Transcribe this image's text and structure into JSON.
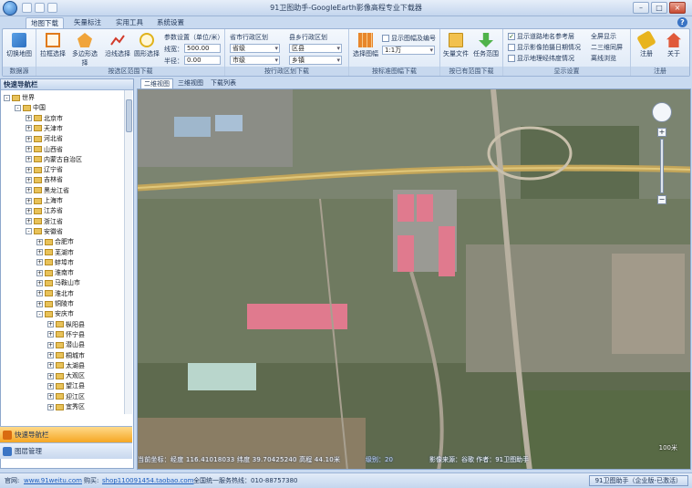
{
  "window": {
    "title": "91卫图助手-GoogleEarth影像高程专业下载器"
  },
  "ribbon_tabs": [
    "地图下载",
    "矢量标注",
    "实用工具",
    "系统设置"
  ],
  "groups": {
    "data_source": {
      "label": "数据源",
      "switch_map": "切换地图"
    },
    "range": {
      "label": "按选区范围下载",
      "rect_select": "拉框选择",
      "polygon_select": "多边形选择",
      "polyline_select": "沿线选择",
      "circle_select": "圆形选择",
      "params_title": "参数设置（单位/米）",
      "width_label": "线宽：",
      "width_value": "500.00",
      "radius_label": "半径：",
      "radius_value": "0.00"
    },
    "admin": {
      "label": "按行政区划下载",
      "prov_title": "省市行政区划",
      "province": "省级",
      "city": "市级",
      "county_title": "县乡行政区划",
      "district": "区县",
      "town": "乡镇"
    },
    "sheet": {
      "label": "按标准图幅下载",
      "select_sheet": "选择图幅",
      "show_sheet_option": "显示图幅及编号",
      "scale_value": "1:1万"
    },
    "existing": {
      "label": "按已有范围下载",
      "vector_file": "矢量文件",
      "task_range": "任务范围"
    },
    "display": {
      "label": "显示设置",
      "opt1": "显示道路地名参考层",
      "opt2": "显示影像拍摄日期情况",
      "opt3": "显示地理经纬度情况",
      "opt4": "全屏显示",
      "opt5": "二三维同屏",
      "opt6": "离线浏览"
    },
    "register": {
      "label": "注册",
      "register": "注册",
      "about": "关于"
    }
  },
  "nav": {
    "header": "快速导航栏",
    "tree": [
      {
        "label": "世界",
        "level": 0,
        "sign": "-"
      },
      {
        "label": "中国",
        "level": 1,
        "sign": "-"
      },
      {
        "label": "北京市",
        "level": 2,
        "sign": "+"
      },
      {
        "label": "天津市",
        "level": 2,
        "sign": "+"
      },
      {
        "label": "河北省",
        "level": 2,
        "sign": "+"
      },
      {
        "label": "山西省",
        "level": 2,
        "sign": "+"
      },
      {
        "label": "内蒙古自治区",
        "level": 2,
        "sign": "+"
      },
      {
        "label": "辽宁省",
        "level": 2,
        "sign": "+"
      },
      {
        "label": "吉林省",
        "level": 2,
        "sign": "+"
      },
      {
        "label": "黑龙江省",
        "level": 2,
        "sign": "+"
      },
      {
        "label": "上海市",
        "level": 2,
        "sign": "+"
      },
      {
        "label": "江苏省",
        "level": 2,
        "sign": "+"
      },
      {
        "label": "浙江省",
        "level": 2,
        "sign": "+"
      },
      {
        "label": "安徽省",
        "level": 2,
        "sign": "-"
      },
      {
        "label": "合肥市",
        "level": 3,
        "sign": "+"
      },
      {
        "label": "芜湖市",
        "level": 3,
        "sign": "+"
      },
      {
        "label": "蚌埠市",
        "level": 3,
        "sign": "+"
      },
      {
        "label": "淮南市",
        "level": 3,
        "sign": "+"
      },
      {
        "label": "马鞍山市",
        "level": 3,
        "sign": "+"
      },
      {
        "label": "淮北市",
        "level": 3,
        "sign": "+"
      },
      {
        "label": "铜陵市",
        "level": 3,
        "sign": "+"
      },
      {
        "label": "安庆市",
        "level": 3,
        "sign": "-"
      },
      {
        "label": "枞阳县",
        "level": 4,
        "sign": "+"
      },
      {
        "label": "怀宁县",
        "level": 4,
        "sign": "+"
      },
      {
        "label": "潜山县",
        "level": 4,
        "sign": "+"
      },
      {
        "label": "桐城市",
        "level": 4,
        "sign": "+"
      },
      {
        "label": "太湖县",
        "level": 4,
        "sign": "+"
      },
      {
        "label": "大观区",
        "level": 4,
        "sign": "+"
      },
      {
        "label": "望江县",
        "level": 4,
        "sign": "+"
      },
      {
        "label": "迎江区",
        "level": 4,
        "sign": "+"
      },
      {
        "label": "宜秀区",
        "level": 4,
        "sign": "+"
      }
    ],
    "quick_nav": "快速导航栏",
    "layer_manage": "图层管理"
  },
  "map_tabs": [
    "二维视图",
    "三维视图",
    "下载列表"
  ],
  "map": {
    "caption": "当前坐标：经度 116.41018033 纬度 39.70425240 高程 44.10米",
    "zoom_level": "级别：20",
    "copyright": "影像来源：谷歌  作者：91卫图助手",
    "scale": "100米"
  },
  "status": {
    "site_label": "官网:",
    "site_url": "www.91weitu.com",
    "shop_label": "购买:",
    "shop_url": "shop110091454.taobao.com",
    "hotline": "全国统一服务热线：010-88757380",
    "edition": "91卫图助手（企业版-已激活）"
  },
  "colors": {
    "accent": "#3a74c4",
    "ribbon_bg": "#dde8f6",
    "nav_active": "#f5a623"
  }
}
